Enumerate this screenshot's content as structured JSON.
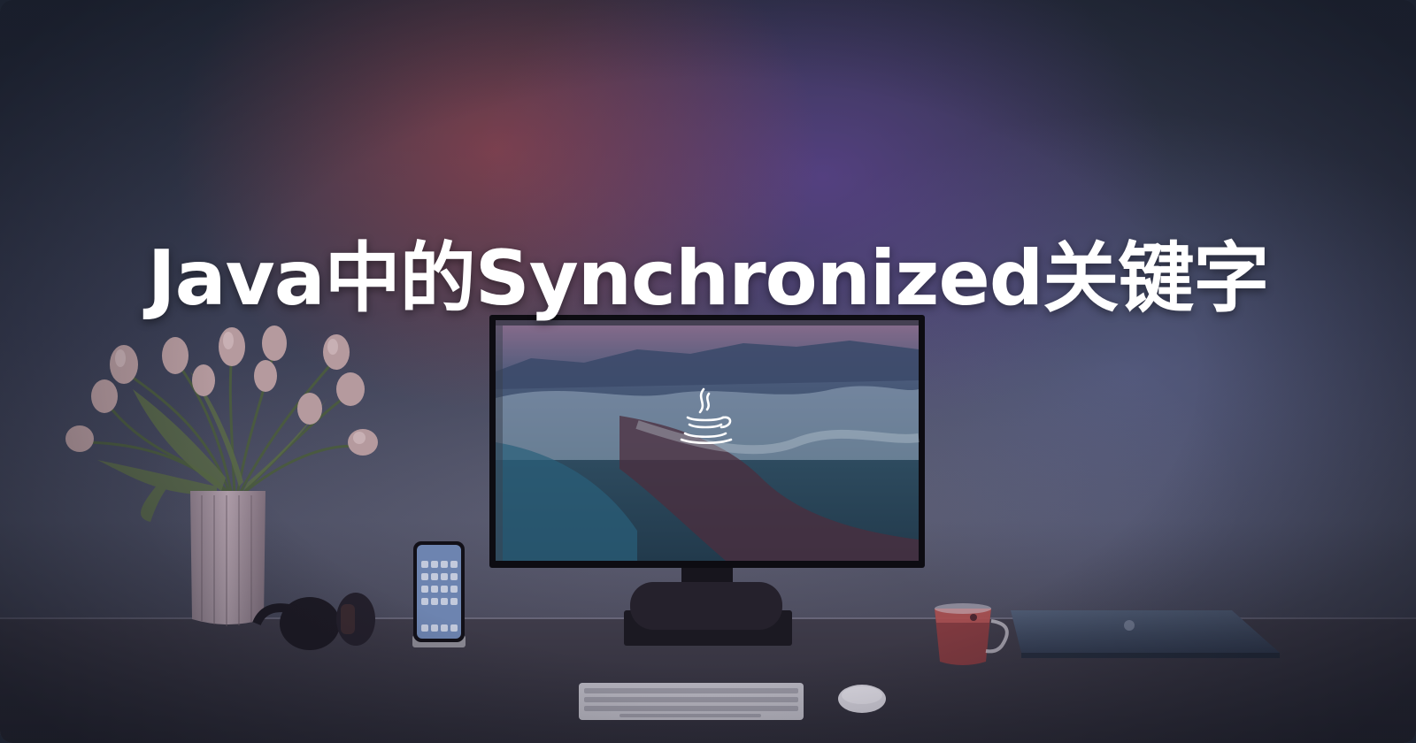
{
  "title": "Java中的Synchronized关键字",
  "logo": {
    "icon": "java-coffee-cup-icon"
  },
  "colors": {
    "title_text": "#ffffff",
    "background_dark": "#2b3142",
    "glow_red": "#b44650",
    "glow_purple": "#6e46aa"
  }
}
